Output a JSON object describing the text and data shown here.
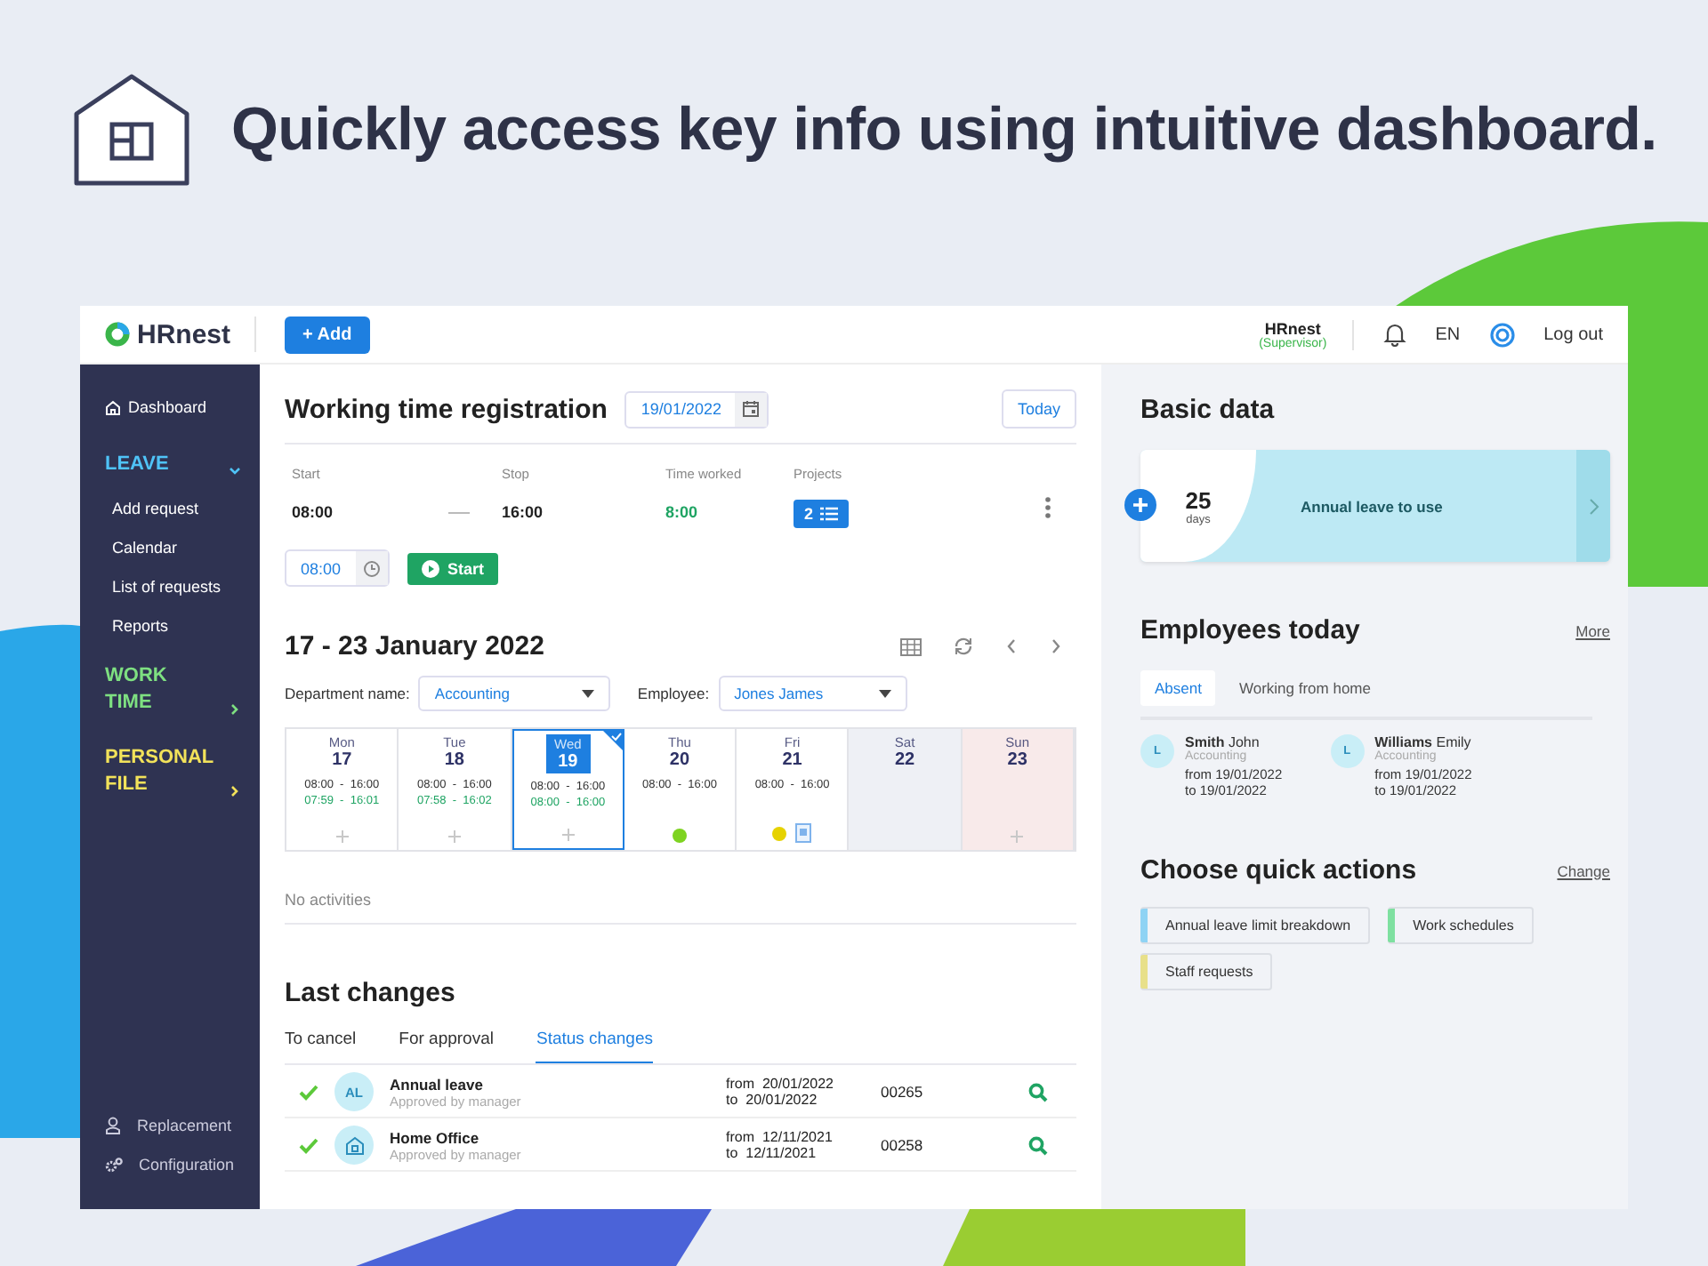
{
  "headline": "Quickly access key info using intuitive dashboard.",
  "topbar": {
    "logo": "HRnest",
    "add_button": "+ Add",
    "user_name": "HRnest",
    "user_role": "(Supervisor)",
    "language": "EN",
    "logout": "Log out"
  },
  "sidebar": {
    "items": [
      {
        "kind": "link",
        "label": "Dashboard"
      },
      {
        "kind": "section",
        "label": "LEAVE",
        "color": "#4fc3f7",
        "expanded": true,
        "children": [
          {
            "label": "Add request"
          },
          {
            "label": "Calendar"
          },
          {
            "label": "List of requests"
          },
          {
            "label": "Reports"
          }
        ]
      },
      {
        "kind": "section",
        "label": "WORK TIME",
        "color": "#7ee081",
        "expanded": false
      },
      {
        "kind": "section",
        "label": "PERSONAL FILE",
        "color": "#f2e25a",
        "expanded": false
      }
    ],
    "bottom": [
      {
        "kind": "person",
        "label": "Replacement"
      },
      {
        "kind": "gears",
        "label": "Configuration"
      }
    ]
  },
  "working_time": {
    "title": "Working time registration",
    "date": "19/01/2022",
    "today_button": "Today",
    "start_label": "Start",
    "stop_label": "Stop",
    "worked_label": "Time worked",
    "projects_label": "Projects",
    "start": "08:00",
    "stop": "16:00",
    "worked": "8:00",
    "projects": "2",
    "time_field": "08:00",
    "start_button": "Start"
  },
  "week": {
    "title": "17 - 23 January 2022",
    "department_label": "Department name:",
    "department": "Accounting",
    "employee_label": "Employee:",
    "employee": "Jones James",
    "days": [
      {
        "kind": "workday",
        "weekday": "Mon",
        "date": "17",
        "planned": "08:00  -  16:00",
        "actual": "07:59  -  16:01",
        "selected": false,
        "addable": true
      },
      {
        "kind": "workday",
        "weekday": "Tue",
        "date": "18",
        "planned": "08:00  -  16:00",
        "actual": "07:58  -  16:02",
        "selected": false,
        "addable": true
      },
      {
        "kind": "workday",
        "weekday": "Wed",
        "date": "19",
        "planned": "08:00  -  16:00",
        "actual": "08:00  -  16:00",
        "selected": true,
        "addable": true
      },
      {
        "kind": "workday",
        "weekday": "Thu",
        "date": "20",
        "planned": "08:00  -  16:00",
        "selected": false,
        "addable": false,
        "markers": [
          {
            "kind": "dot",
            "color": "#7ed321"
          }
        ]
      },
      {
        "kind": "workday",
        "weekday": "Fri",
        "date": "21",
        "planned": "08:00  -  16:00",
        "selected": false,
        "addable": false,
        "markers": [
          {
            "kind": "dot",
            "color": "#e6d200"
          },
          {
            "kind": "document"
          }
        ]
      },
      {
        "kind": "saturday",
        "weekday": "Sat",
        "date": "22",
        "selected": false,
        "addable": false
      },
      {
        "kind": "sunday",
        "weekday": "Sun",
        "date": "23",
        "selected": false,
        "addable": true
      }
    ],
    "no_activities": "No activities"
  },
  "last_changes": {
    "title": "Last changes",
    "tabs": [
      {
        "label": "To cancel",
        "selected": false
      },
      {
        "label": "For approval",
        "selected": false
      },
      {
        "label": "Status changes",
        "selected": true
      }
    ],
    "rows": [
      {
        "kind": "initials",
        "initials": "AL",
        "title": "Annual leave",
        "status": "Approved by manager",
        "from": "from  20/01/2022",
        "to": "to  20/01/2022",
        "number": "00265"
      },
      {
        "kind": "home",
        "title": "Home Office",
        "status": "Approved by manager",
        "from": "from  12/11/2021",
        "to": "to  12/11/2021",
        "number": "00258"
      }
    ]
  },
  "basic_data": {
    "title": "Basic data",
    "value": "25",
    "unit": "days",
    "label": "Annual leave to use"
  },
  "employees_today": {
    "title": "Employees today",
    "more_link": "More",
    "tabs": [
      {
        "label": "Absent",
        "selected": true
      },
      {
        "label": "Working from home",
        "selected": false
      }
    ],
    "people": [
      {
        "initial": "L",
        "name": "**Smith** John",
        "department": "Accounting",
        "from": "from 19/01/2022",
        "to": "to 19/01/2022"
      },
      {
        "initial": "L",
        "name": "**Williams** Emily",
        "department": "Accounting",
        "from": "from 19/01/2022",
        "to": "to 19/01/2022"
      }
    ]
  },
  "quick_actions": {
    "title": "Choose quick actions",
    "change_link": "Change",
    "actions": [
      {
        "label": "Annual leave limit breakdown",
        "color": "#8fd3f4"
      },
      {
        "label": "Work schedules",
        "color": "#7ee0a0"
      },
      {
        "label": "Staff requests",
        "color": "#e8e08a"
      }
    ]
  }
}
